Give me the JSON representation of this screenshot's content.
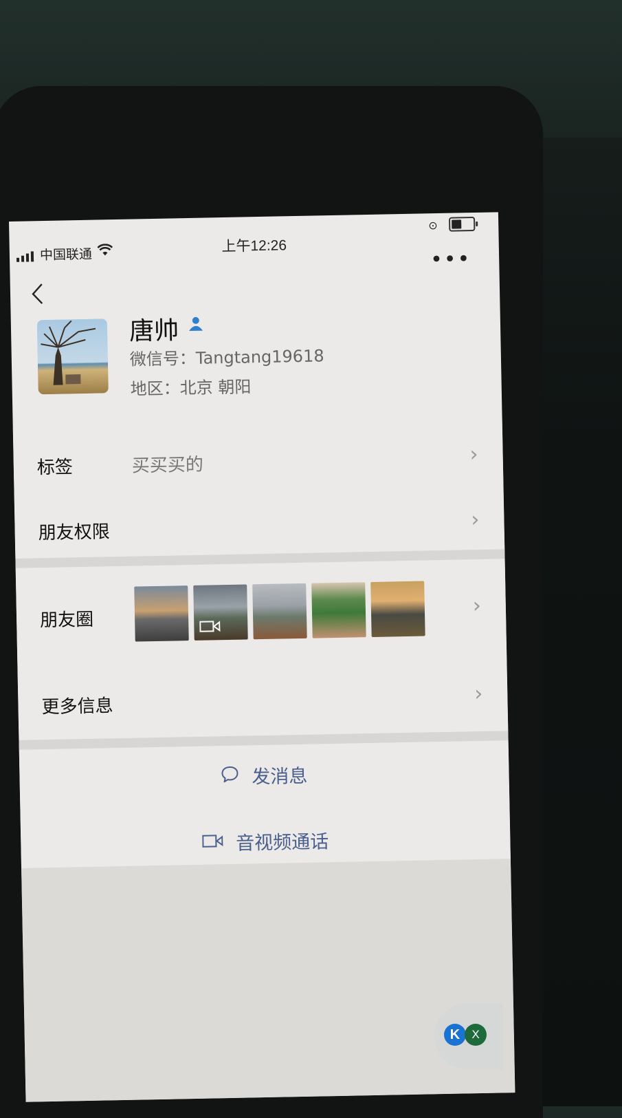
{
  "status_bar": {
    "carrier": "中国联通",
    "time": "上午12:26"
  },
  "profile": {
    "name": "唐帅",
    "wechat_id": "微信号：Tangtang19618",
    "region": "地区：北京 朝阳"
  },
  "rows": {
    "tags_label": "标签",
    "tags_value": "买买买的",
    "permissions_label": "朋友权限",
    "moments_label": "朋友圈",
    "more_info_label": "更多信息"
  },
  "moments_thumbs": [
    {
      "icon": "street-photo",
      "video": false
    },
    {
      "icon": "video-thumbnail",
      "video": true
    },
    {
      "icon": "street-photo",
      "video": false
    },
    {
      "icon": "tree-photo",
      "video": false
    },
    {
      "icon": "city-photo",
      "video": false
    }
  ],
  "actions": {
    "message": "发消息",
    "call": "音视频通话"
  },
  "floating": {
    "k": "K",
    "x": "X"
  },
  "colors": {
    "link_blue": "#4a5f8d",
    "contact_icon": "#2f7fd1"
  }
}
